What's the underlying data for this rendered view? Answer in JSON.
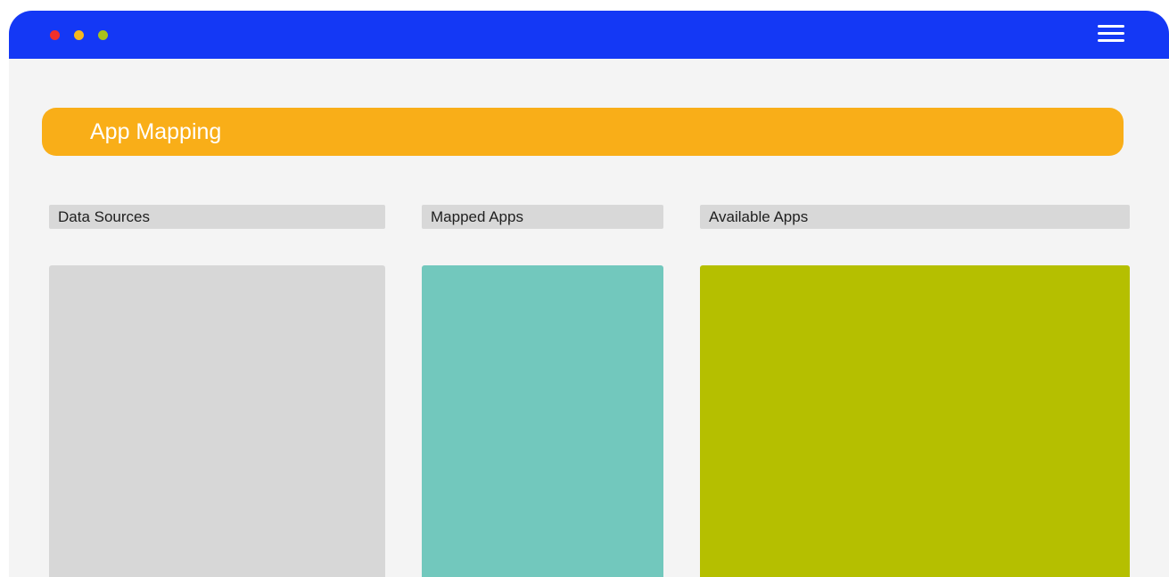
{
  "window": {
    "controls": [
      {
        "name": "close",
        "color": "#f0302a"
      },
      {
        "name": "minimize",
        "color": "#f5b81c"
      },
      {
        "name": "maximize",
        "color": "#a9c21a"
      }
    ],
    "titlebar_color": "#1438f5",
    "menu_icon": "hamburger-menu-icon"
  },
  "banner": {
    "title": "App Mapping",
    "color": "#f9ae18"
  },
  "columns": [
    {
      "header": "Data Sources",
      "panel_color": "#d7d7d7"
    },
    {
      "header": "Mapped Apps",
      "panel_color": "#72c8bd"
    },
    {
      "header": "Available Apps",
      "panel_color": "#b5bf00"
    }
  ]
}
